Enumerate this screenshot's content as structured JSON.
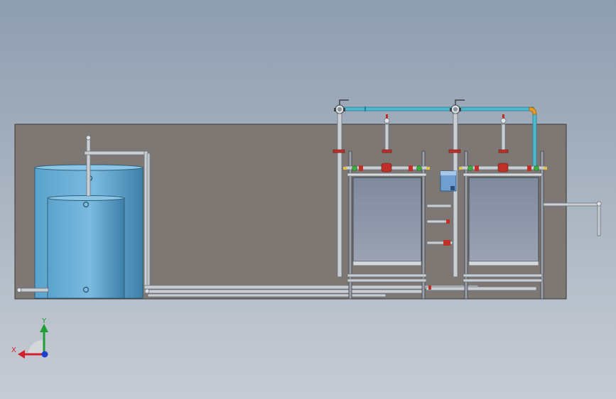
{
  "viewport": {
    "colors": {
      "background_top": "#8e9db0",
      "background_bottom": "#c6ccd4",
      "base_plate": "#7d7873",
      "tank": "#6eaed4",
      "tank_dark": "#3d82aa",
      "pipe": "#c9ced4",
      "pipe_dark": "#7f858c",
      "blue_pipe": "#4fb8cc",
      "elbow": "#e39a2b",
      "valve_red": "#c0302a",
      "valve_green": "#3cae3f",
      "panel": "#8c95a8",
      "dosing_box": "#5d8cc0"
    }
  },
  "triad": {
    "x_label": "X",
    "y_label": "Y",
    "x_color": "#d2202a",
    "y_color": "#1f9e36",
    "z_color": "#1f3fd1"
  }
}
